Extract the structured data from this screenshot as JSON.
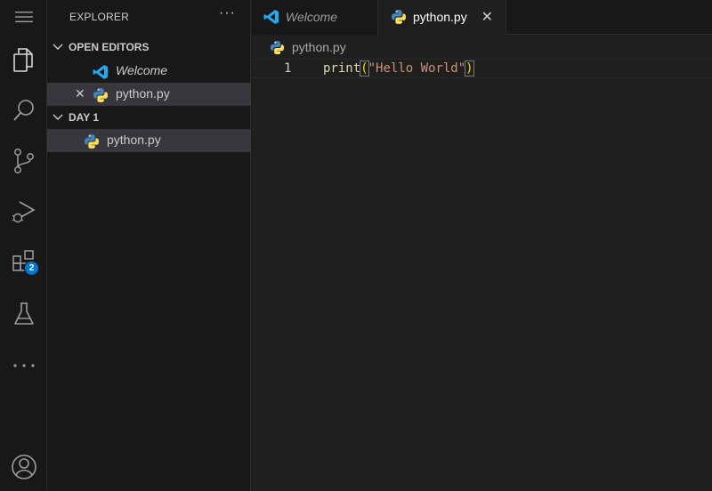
{
  "activity_bar": {
    "items": [
      {
        "name": "menu-icon"
      },
      {
        "name": "explorer-icon"
      },
      {
        "name": "search-icon"
      },
      {
        "name": "source-control-icon"
      },
      {
        "name": "run-debug-icon"
      },
      {
        "name": "extensions-icon",
        "badge": "2"
      },
      {
        "name": "testing-icon"
      },
      {
        "name": "more-icon"
      },
      {
        "name": "account-icon"
      }
    ]
  },
  "sidebar": {
    "title": "EXPLORER",
    "more": "···",
    "open_editors": {
      "label": "OPEN EDITORS",
      "items": [
        {
          "label": "Welcome",
          "icon": "vscode-icon"
        },
        {
          "label": "python.py",
          "icon": "python-icon",
          "close": "✕"
        }
      ]
    },
    "folder": {
      "label": "DAY 1",
      "items": [
        {
          "label": "python.py",
          "icon": "python-icon"
        }
      ]
    }
  },
  "tabs": [
    {
      "label": "Welcome",
      "icon": "vscode-icon",
      "active": false
    },
    {
      "label": "python.py",
      "icon": "python-icon",
      "active": true,
      "close": "✕"
    }
  ],
  "editor": {
    "breadcrumb": "python.py",
    "lines": [
      {
        "number": "1",
        "fn": "print",
        "open": "(",
        "string": "\"Hello World\"",
        "close": ")"
      }
    ]
  },
  "colors": {
    "background": "#1e1e1e",
    "sidebar": "#181818",
    "selection": "#37373d",
    "badge": "#0078d4",
    "vscode_blue": "#23a9f2",
    "python_blue": "#4584b6",
    "python_yellow": "#ffde57"
  }
}
